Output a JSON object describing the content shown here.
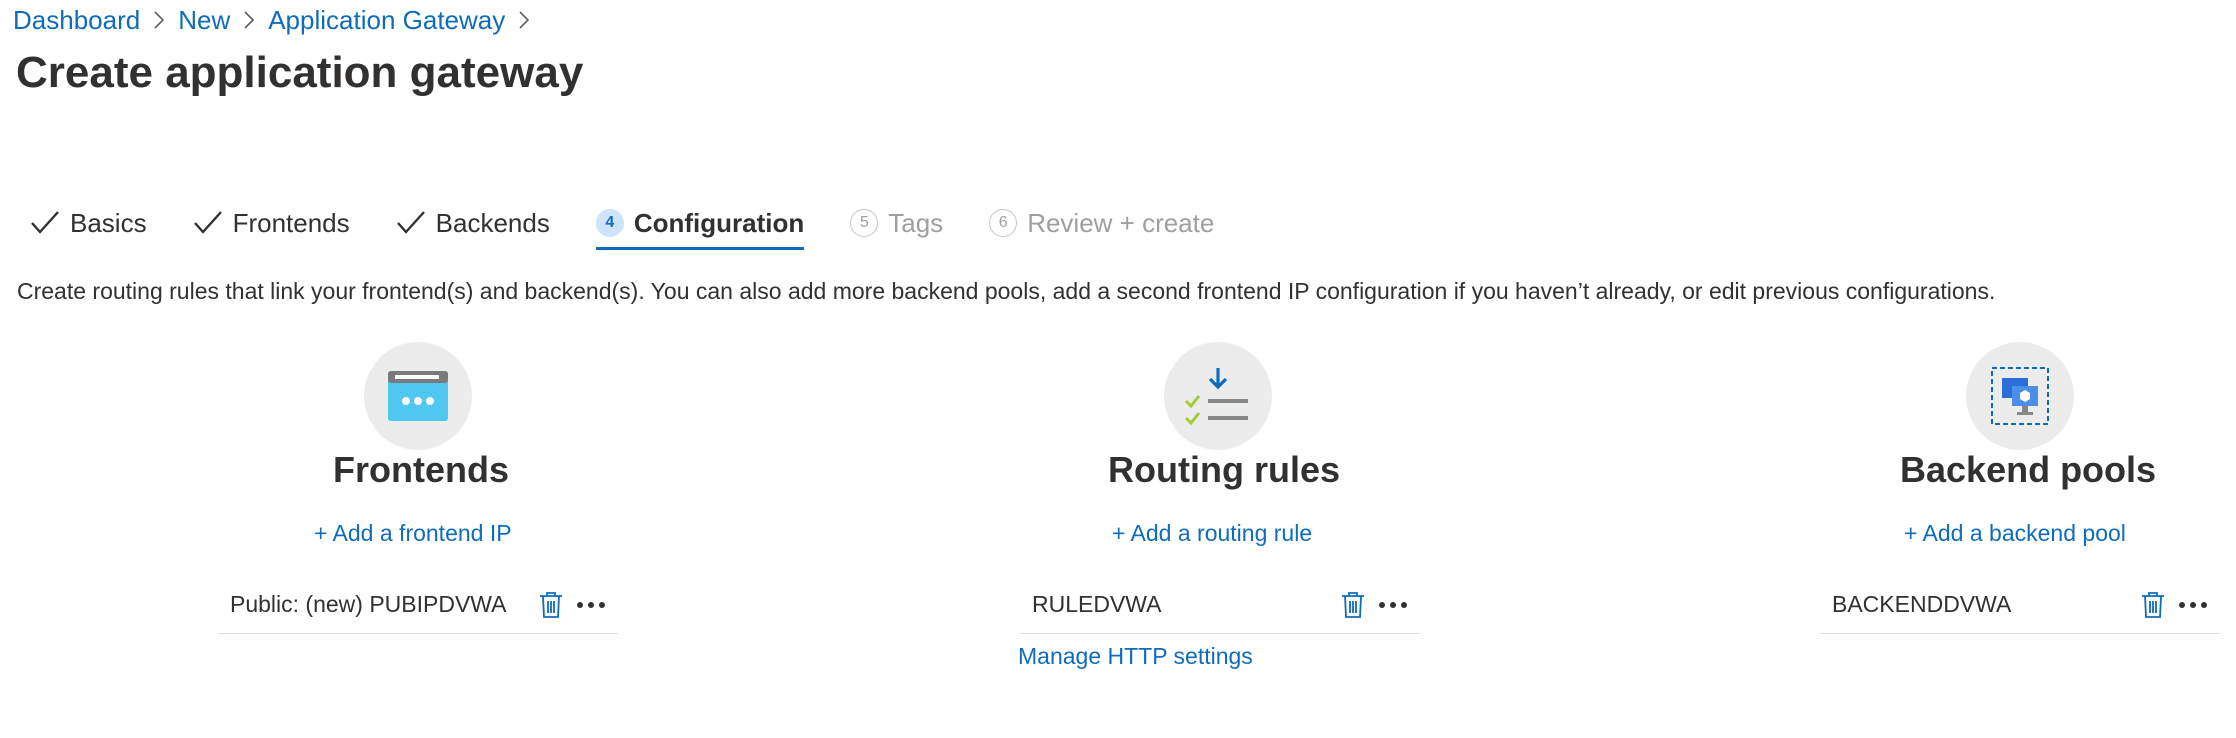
{
  "breadcrumb": {
    "items": [
      {
        "label": "Dashboard"
      },
      {
        "label": "New"
      },
      {
        "label": "Application Gateway"
      }
    ]
  },
  "page": {
    "title": "Create application gateway"
  },
  "tabs": [
    {
      "label": "Basics",
      "state": "completed"
    },
    {
      "label": "Frontends",
      "state": "completed"
    },
    {
      "label": "Backends",
      "state": "completed"
    },
    {
      "label": "Configuration",
      "number": "4",
      "state": "active"
    },
    {
      "label": "Tags",
      "number": "5",
      "state": "disabled"
    },
    {
      "label": "Review + create",
      "number": "6",
      "state": "disabled"
    }
  ],
  "description": "Create routing rules that link your frontend(s) and backend(s). You can also add more backend pools, add a second frontend IP configuration if you haven’t already, or edit previous configurations.",
  "frontends": {
    "icon": "frontend-ip-icon",
    "title": "Frontends",
    "add_label": "+ Add a frontend IP",
    "items": [
      {
        "name": "Public: (new) PUBIPDVWA"
      }
    ]
  },
  "routing": {
    "icon": "routing-rules-icon",
    "title": "Routing rules",
    "add_label": "+ Add a routing rule",
    "items": [
      {
        "name": "RULEDVWA"
      }
    ],
    "manage_label": "Manage HTTP settings"
  },
  "backends": {
    "icon": "backend-pool-icon",
    "title": "Backend pools",
    "add_label": "+ Add a backend pool",
    "items": [
      {
        "name": "BACKENDDVWA"
      }
    ]
  },
  "colors": {
    "accent": "#0f6cbd",
    "text": "#323130",
    "disabled": "#a19f9d"
  }
}
